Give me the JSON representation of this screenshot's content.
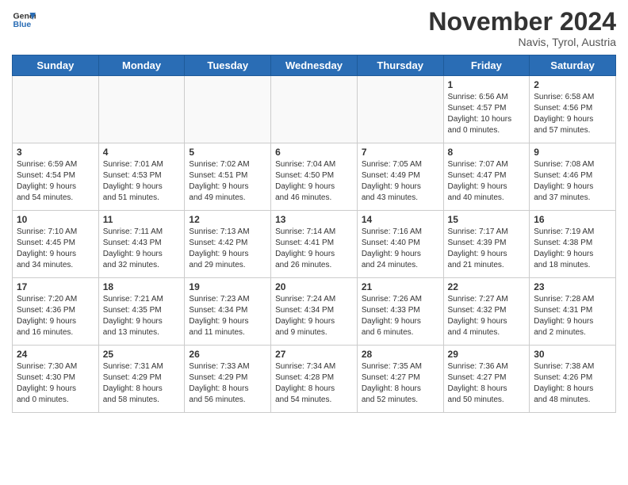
{
  "header": {
    "logo_line1": "General",
    "logo_line2": "Blue",
    "month_title": "November 2024",
    "location": "Navis, Tyrol, Austria"
  },
  "weekdays": [
    "Sunday",
    "Monday",
    "Tuesday",
    "Wednesday",
    "Thursday",
    "Friday",
    "Saturday"
  ],
  "weeks": [
    [
      {
        "day": "",
        "info": ""
      },
      {
        "day": "",
        "info": ""
      },
      {
        "day": "",
        "info": ""
      },
      {
        "day": "",
        "info": ""
      },
      {
        "day": "",
        "info": ""
      },
      {
        "day": "1",
        "info": "Sunrise: 6:56 AM\nSunset: 4:57 PM\nDaylight: 10 hours\nand 0 minutes."
      },
      {
        "day": "2",
        "info": "Sunrise: 6:58 AM\nSunset: 4:56 PM\nDaylight: 9 hours\nand 57 minutes."
      }
    ],
    [
      {
        "day": "3",
        "info": "Sunrise: 6:59 AM\nSunset: 4:54 PM\nDaylight: 9 hours\nand 54 minutes."
      },
      {
        "day": "4",
        "info": "Sunrise: 7:01 AM\nSunset: 4:53 PM\nDaylight: 9 hours\nand 51 minutes."
      },
      {
        "day": "5",
        "info": "Sunrise: 7:02 AM\nSunset: 4:51 PM\nDaylight: 9 hours\nand 49 minutes."
      },
      {
        "day": "6",
        "info": "Sunrise: 7:04 AM\nSunset: 4:50 PM\nDaylight: 9 hours\nand 46 minutes."
      },
      {
        "day": "7",
        "info": "Sunrise: 7:05 AM\nSunset: 4:49 PM\nDaylight: 9 hours\nand 43 minutes."
      },
      {
        "day": "8",
        "info": "Sunrise: 7:07 AM\nSunset: 4:47 PM\nDaylight: 9 hours\nand 40 minutes."
      },
      {
        "day": "9",
        "info": "Sunrise: 7:08 AM\nSunset: 4:46 PM\nDaylight: 9 hours\nand 37 minutes."
      }
    ],
    [
      {
        "day": "10",
        "info": "Sunrise: 7:10 AM\nSunset: 4:45 PM\nDaylight: 9 hours\nand 34 minutes."
      },
      {
        "day": "11",
        "info": "Sunrise: 7:11 AM\nSunset: 4:43 PM\nDaylight: 9 hours\nand 32 minutes."
      },
      {
        "day": "12",
        "info": "Sunrise: 7:13 AM\nSunset: 4:42 PM\nDaylight: 9 hours\nand 29 minutes."
      },
      {
        "day": "13",
        "info": "Sunrise: 7:14 AM\nSunset: 4:41 PM\nDaylight: 9 hours\nand 26 minutes."
      },
      {
        "day": "14",
        "info": "Sunrise: 7:16 AM\nSunset: 4:40 PM\nDaylight: 9 hours\nand 24 minutes."
      },
      {
        "day": "15",
        "info": "Sunrise: 7:17 AM\nSunset: 4:39 PM\nDaylight: 9 hours\nand 21 minutes."
      },
      {
        "day": "16",
        "info": "Sunrise: 7:19 AM\nSunset: 4:38 PM\nDaylight: 9 hours\nand 18 minutes."
      }
    ],
    [
      {
        "day": "17",
        "info": "Sunrise: 7:20 AM\nSunset: 4:36 PM\nDaylight: 9 hours\nand 16 minutes."
      },
      {
        "day": "18",
        "info": "Sunrise: 7:21 AM\nSunset: 4:35 PM\nDaylight: 9 hours\nand 13 minutes."
      },
      {
        "day": "19",
        "info": "Sunrise: 7:23 AM\nSunset: 4:34 PM\nDaylight: 9 hours\nand 11 minutes."
      },
      {
        "day": "20",
        "info": "Sunrise: 7:24 AM\nSunset: 4:34 PM\nDaylight: 9 hours\nand 9 minutes."
      },
      {
        "day": "21",
        "info": "Sunrise: 7:26 AM\nSunset: 4:33 PM\nDaylight: 9 hours\nand 6 minutes."
      },
      {
        "day": "22",
        "info": "Sunrise: 7:27 AM\nSunset: 4:32 PM\nDaylight: 9 hours\nand 4 minutes."
      },
      {
        "day": "23",
        "info": "Sunrise: 7:28 AM\nSunset: 4:31 PM\nDaylight: 9 hours\nand 2 minutes."
      }
    ],
    [
      {
        "day": "24",
        "info": "Sunrise: 7:30 AM\nSunset: 4:30 PM\nDaylight: 9 hours\nand 0 minutes."
      },
      {
        "day": "25",
        "info": "Sunrise: 7:31 AM\nSunset: 4:29 PM\nDaylight: 8 hours\nand 58 minutes."
      },
      {
        "day": "26",
        "info": "Sunrise: 7:33 AM\nSunset: 4:29 PM\nDaylight: 8 hours\nand 56 minutes."
      },
      {
        "day": "27",
        "info": "Sunrise: 7:34 AM\nSunset: 4:28 PM\nDaylight: 8 hours\nand 54 minutes."
      },
      {
        "day": "28",
        "info": "Sunrise: 7:35 AM\nSunset: 4:27 PM\nDaylight: 8 hours\nand 52 minutes."
      },
      {
        "day": "29",
        "info": "Sunrise: 7:36 AM\nSunset: 4:27 PM\nDaylight: 8 hours\nand 50 minutes."
      },
      {
        "day": "30",
        "info": "Sunrise: 7:38 AM\nSunset: 4:26 PM\nDaylight: 8 hours\nand 48 minutes."
      }
    ]
  ]
}
